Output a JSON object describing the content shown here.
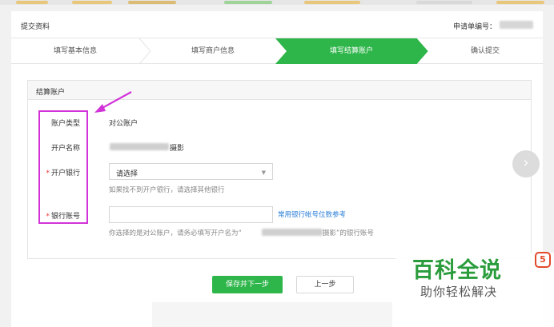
{
  "header": {
    "title": "提交资料",
    "order_label": "申请单编号："
  },
  "steps": [
    {
      "label": "填写基本信息",
      "active": false
    },
    {
      "label": "填写商户信息",
      "active": false
    },
    {
      "label": "填写结算账户",
      "active": true
    },
    {
      "label": "确认提交",
      "active": false
    }
  ],
  "card": {
    "title": "结算账户",
    "account_type": {
      "label": "账户类型",
      "value": "对公账户"
    },
    "account_name": {
      "label": "开户名称",
      "value_suffix": "摄影"
    },
    "bank": {
      "label": "开户银行",
      "required": "*",
      "select_value": "请选择",
      "hint": "如果找不到开户银行，请选择其他银行"
    },
    "account_number": {
      "label": "银行账号",
      "required": "*",
      "link": "常用银行帐号位数参考",
      "hint_prefix": "你选择的是对公账户，请务必填写开户名为“",
      "hint_suffix": "摄影”的银行账号"
    }
  },
  "buttons": {
    "save_next": "保存并下一步",
    "prev": "上一步"
  },
  "watermark": {
    "big": "百科全说",
    "small": "助你轻松解决",
    "badge": "5"
  },
  "colors": {
    "accent_green": "#2fb64b",
    "highlight_magenta": "#d233d8",
    "link_blue": "#2b7fd8",
    "required_red": "#e33333"
  },
  "icons": {
    "next": "chevron-right-icon",
    "dropdown": "caret-down-icon"
  }
}
